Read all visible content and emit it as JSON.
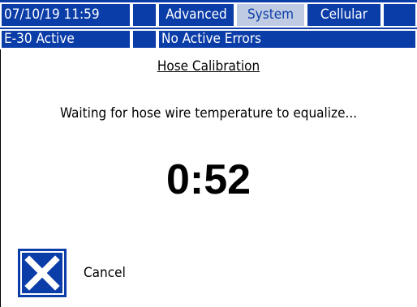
{
  "header": {
    "datetime": "07/10/19 11:59",
    "tabs": [
      {
        "label": "Advanced",
        "selected": false
      },
      {
        "label": "System",
        "selected": true
      },
      {
        "label": "Cellular",
        "selected": false
      }
    ]
  },
  "status": {
    "machine_status": "E-30 Active",
    "errors": "No Active Errors"
  },
  "screen": {
    "title": "Hose Calibration",
    "message": "Waiting for hose wire temperature to equalize...",
    "timer": "0:52"
  },
  "actions": {
    "cancel_label": "Cancel",
    "cancel_icon": "close-x-icon"
  },
  "colors": {
    "bar_blue": "#0b3da8",
    "selected_tab_bg": "#bfcbe3",
    "background": "#ffffff",
    "text": "#000000"
  }
}
